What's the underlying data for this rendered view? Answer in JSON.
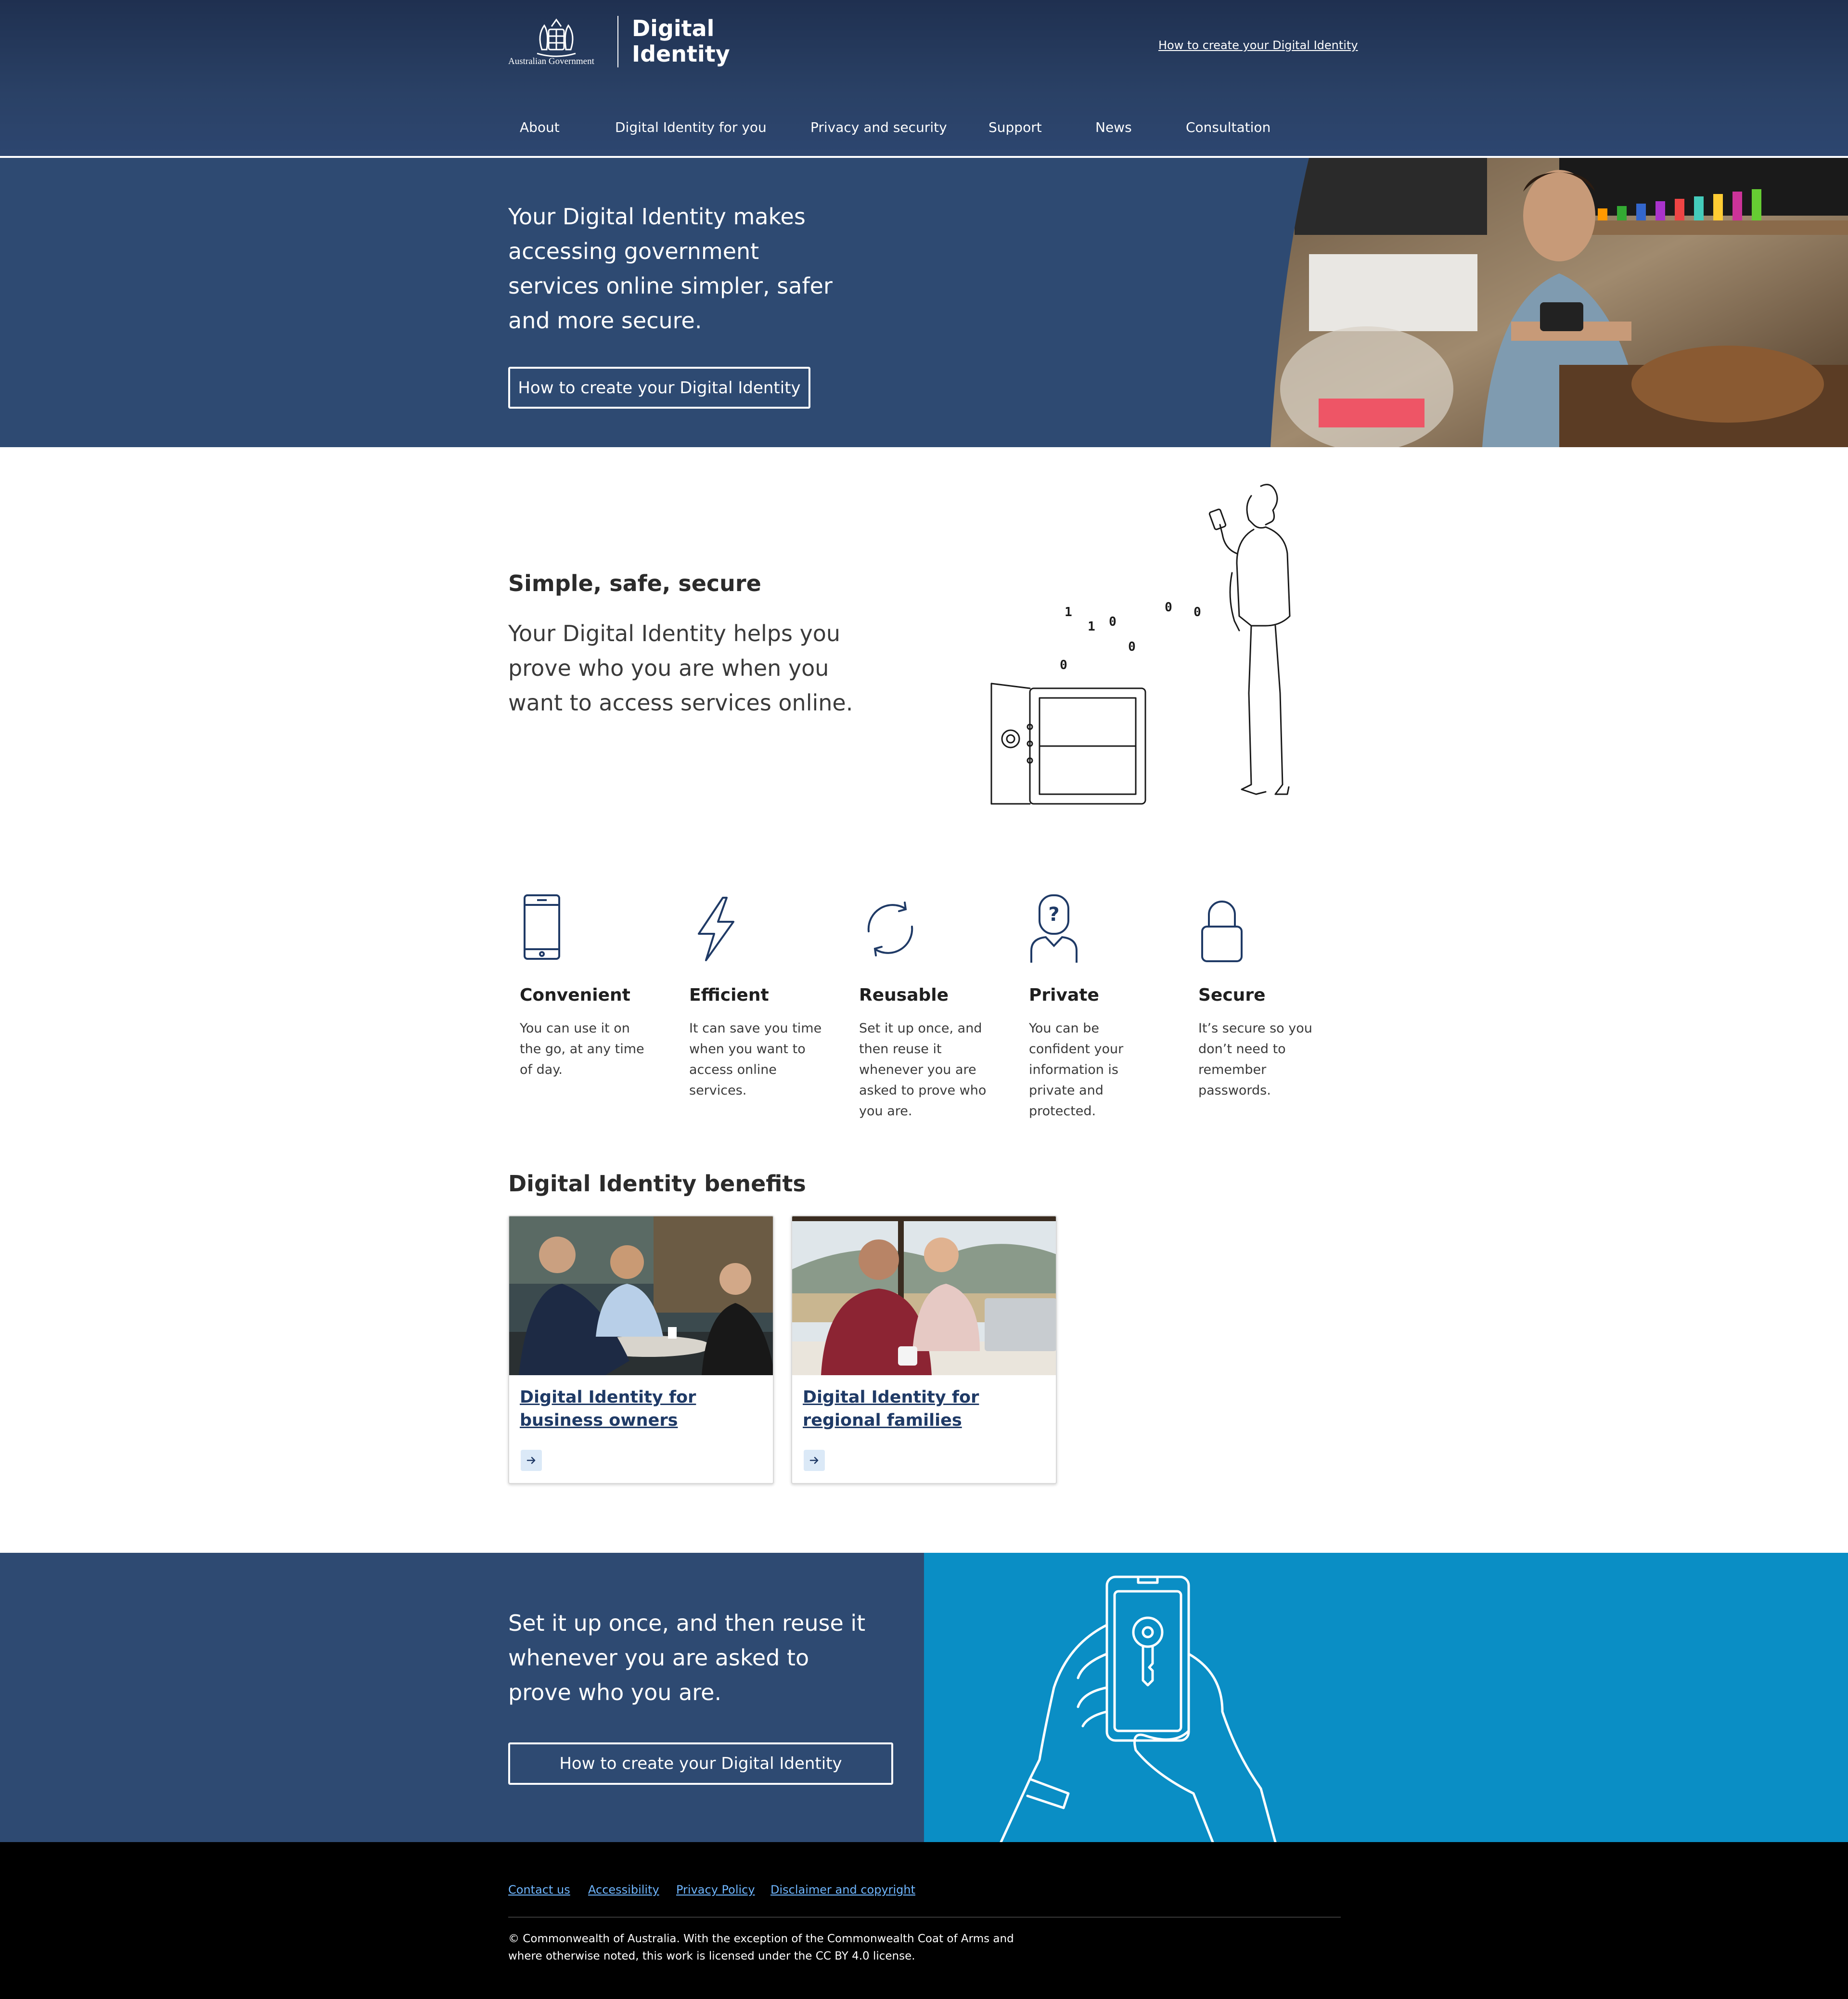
{
  "header": {
    "crest_text": "Australian Government",
    "brand_line1": "Digital",
    "brand_line2": "Identity",
    "top_link": "How to create your Digital Identity"
  },
  "nav": {
    "items": [
      "About",
      "Digital Identity for you",
      "Privacy and security",
      "Support",
      "News",
      "Consultation"
    ]
  },
  "hero": {
    "heading": "Your Digital Identity makes accessing government services online simpler, safer and more secure.",
    "button": "How to create your Digital Identity"
  },
  "intro": {
    "title": "Simple, safe, secure",
    "body": "Your Digital Identity helps you prove who you are when you want to access services online.",
    "binary_digits": [
      "1",
      "1",
      "0",
      "0",
      "0",
      "0",
      "0"
    ]
  },
  "features": [
    {
      "title": "Convenient",
      "text": "You can use it on the go, at any time of day.",
      "icon": "phone-icon"
    },
    {
      "title": "Efficient",
      "text": "It can save you time when you want to access online services.",
      "icon": "lightning-icon"
    },
    {
      "title": "Reusable",
      "text": "Set it up once, and then reuse it whenever you are asked to prove who you are.",
      "icon": "refresh-icon"
    },
    {
      "title": "Private",
      "text": "You can be confident your information is private and protected.",
      "icon": "user-question-icon"
    },
    {
      "title": "Secure",
      "text": "It’s secure so you don’t need to remember passwords.",
      "icon": "lock-icon"
    }
  ],
  "benefits": {
    "title": "Digital Identity benefits",
    "cards": [
      {
        "title": "Digital Identity for business owners"
      },
      {
        "title": "Digital Identity for regional families"
      }
    ]
  },
  "cta": {
    "heading": "Set it up once, and then reuse it whenever you are asked to prove who you are.",
    "button": "How to create your Digital Identity"
  },
  "footer": {
    "links": [
      "Contact us",
      "Accessibility",
      "Privacy Policy",
      "Disclaimer and copyright"
    ],
    "copyright": "© Commonwealth of Australia. With the exception of the Commonwealth Coat of Arms and where otherwise noted, this work is licensed under the CC BY 4.0 license."
  },
  "colors": {
    "header_dark": "#1f3050",
    "navy": "#2e4a72",
    "cta_blue": "#0a8ec5",
    "link_blue": "#1f3a66",
    "footer_link": "#6fb6ff"
  }
}
